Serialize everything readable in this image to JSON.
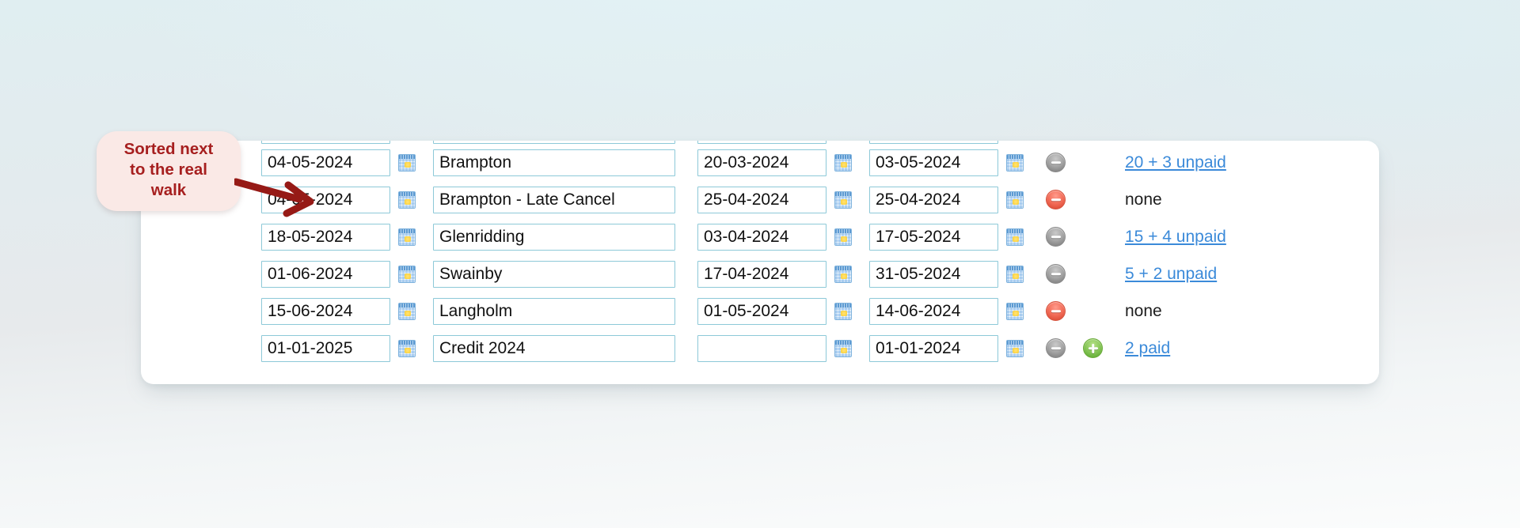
{
  "annotation": {
    "lines": [
      "Sorted next",
      "to the real",
      "walk"
    ],
    "arrow_color": "#961a16",
    "bubble_bg": "#fae9e6",
    "text_color": "#a61f1f"
  },
  "theme": {
    "field_border": "#8dc9d8",
    "link_color": "#3b8ad9",
    "panel_bg": "#ffffff"
  },
  "icons": {
    "calendar": "calendar-icon",
    "remove": "minus-circle-icon",
    "add": "plus-circle-icon"
  },
  "table": {
    "columns": [
      "walk_date",
      "calendar_1",
      "walk_name",
      "open_date",
      "calendar_2",
      "close_date",
      "calendar_3",
      "remove",
      "add",
      "status"
    ],
    "rows": [
      {
        "walk_date": "04-05-2024",
        "walk_name": "Brampton",
        "open_date": "20-03-2024",
        "close_date": "03-05-2024",
        "remove_state": "grey",
        "has_add": false,
        "status_text": "20 + 3 unpaid",
        "status_is_link": true
      },
      {
        "walk_date": "04-05-2024",
        "walk_name": "Brampton - Late Cancel",
        "open_date": "25-04-2024",
        "close_date": "25-04-2024",
        "remove_state": "red",
        "has_add": false,
        "status_text": "none",
        "status_is_link": false
      },
      {
        "walk_date": "18-05-2024",
        "walk_name": "Glenridding",
        "open_date": "03-04-2024",
        "close_date": "17-05-2024",
        "remove_state": "grey",
        "has_add": false,
        "status_text": "15 + 4 unpaid",
        "status_is_link": true
      },
      {
        "walk_date": "01-06-2024",
        "walk_name": "Swainby",
        "open_date": "17-04-2024",
        "close_date": "31-05-2024",
        "remove_state": "grey",
        "has_add": false,
        "status_text": "5 + 2 unpaid",
        "status_is_link": true
      },
      {
        "walk_date": "15-06-2024",
        "walk_name": "Langholm",
        "open_date": "01-05-2024",
        "close_date": "14-06-2024",
        "remove_state": "red",
        "has_add": false,
        "status_text": "none",
        "status_is_link": false
      },
      {
        "walk_date": "01-01-2025",
        "walk_name": "Credit 2024",
        "open_date": "",
        "close_date": "01-01-2024",
        "remove_state": "grey",
        "has_add": true,
        "status_text": "2 paid",
        "status_is_link": true
      }
    ]
  }
}
